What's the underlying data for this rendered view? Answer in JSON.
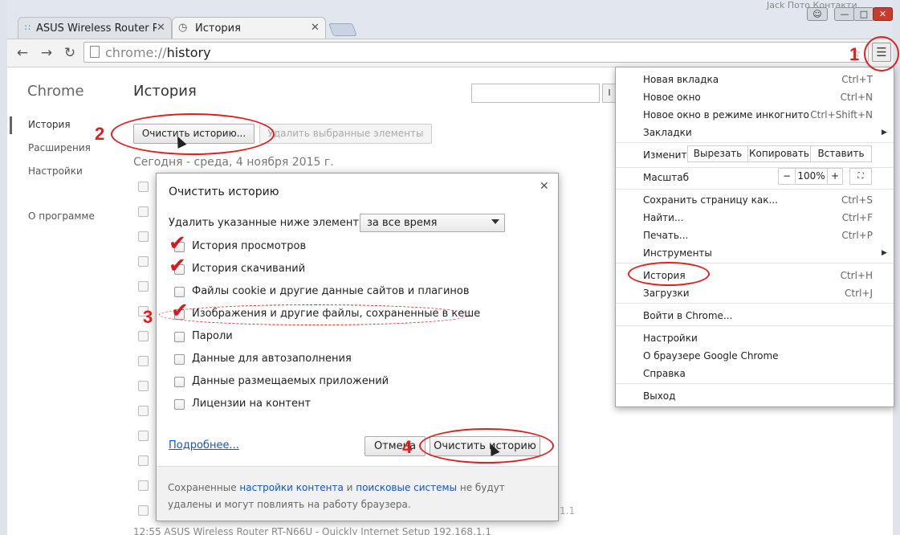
{
  "tabs": [
    {
      "label": "ASUS Wireless Router R",
      "icon": "wifi-icon"
    },
    {
      "label": "История",
      "icon": "history-clock-icon"
    }
  ],
  "window": {
    "top_text": "Jack   Пото   Контакти"
  },
  "address": {
    "scheme": "chrome://",
    "host": "history"
  },
  "sidebar": {
    "brand": "Chrome",
    "items": [
      "История",
      "Расширения",
      "Настройки"
    ],
    "about": "О программе"
  },
  "page": {
    "title": "История",
    "search_btn": "I",
    "clear_btn": "Очистить историю...",
    "delete_btn": "Удалить выбранные элементы",
    "date_heading": "Сегодня - среда, 4 ноября 2015 г.",
    "bottom_row": "12:55      ASUS Wireless Router RT-N66U - Quickly Internet Setup  192.168.1.1",
    "bottom_row2": "1.1"
  },
  "dialog": {
    "title": "Очистить историю",
    "remove_label": "Удалить указанные ниже элементы:",
    "period": "за все время",
    "options": [
      {
        "label": "История просмотров",
        "checked": true
      },
      {
        "label": "История скачиваний",
        "checked": true
      },
      {
        "label": "Файлы cookie и другие данные сайтов и плагинов",
        "checked": false
      },
      {
        "label": "Изображения и другие файлы, сохраненные в кеше",
        "checked": true
      },
      {
        "label": "Пароли",
        "checked": false
      },
      {
        "label": "Данные для автозаполнения",
        "checked": false
      },
      {
        "label": "Данные размещаемых приложений",
        "checked": false
      },
      {
        "label": "Лицензии на контент",
        "checked": false
      }
    ],
    "more_link": "Подробнее...",
    "cancel": "Отмена",
    "confirm": "Очистить историю",
    "footer_1": "Сохраненные ",
    "footer_link1": "настройки контента",
    "footer_2": " и ",
    "footer_link2": "поисковые системы",
    "footer_3": " не будут",
    "footer_4": "удалены и могут повлиять на работу браузера."
  },
  "menu": {
    "new_tab": "Новая вкладка",
    "new_tab_sc": "Ctrl+T",
    "new_window": "Новое окно",
    "new_window_sc": "Ctrl+N",
    "incognito": "Новое окно в режиме инкогнито",
    "incognito_sc": "Ctrl+Shift+N",
    "bookmarks": "Закладки",
    "edit": "Изменить",
    "cut": "Вырезать",
    "copy": "Копировать",
    "paste": "Вставить",
    "zoom": "Масштаб",
    "zoom_minus": "−",
    "zoom_value": "100%",
    "zoom_plus": "+",
    "save_page": "Сохранить страницу как...",
    "save_page_sc": "Ctrl+S",
    "find": "Найти...",
    "find_sc": "Ctrl+F",
    "print": "Печать...",
    "print_sc": "Ctrl+P",
    "tools": "Инструменты",
    "history": "История",
    "history_sc": "Ctrl+H",
    "downloads": "Загрузки",
    "downloads_sc": "Ctrl+J",
    "signin": "Войти в Chrome...",
    "settings": "Настройки",
    "about": "О браузере Google Chrome",
    "help": "Справка",
    "exit": "Выход"
  },
  "annotations": {
    "n1": "1",
    "n2": "2",
    "n3": "3",
    "n4": "4",
    "color": "#e02020"
  }
}
